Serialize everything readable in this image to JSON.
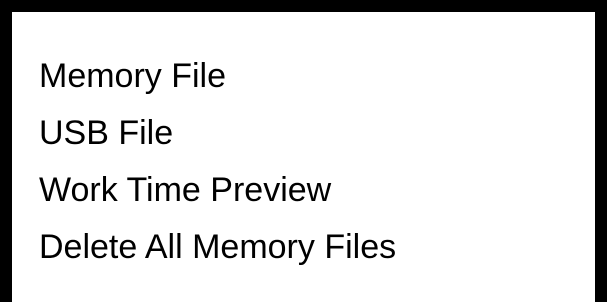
{
  "menu": {
    "items": [
      {
        "label": "Memory File"
      },
      {
        "label": "USB File"
      },
      {
        "label": "Work Time Preview"
      },
      {
        "label": "Delete All Memory Files"
      }
    ]
  }
}
